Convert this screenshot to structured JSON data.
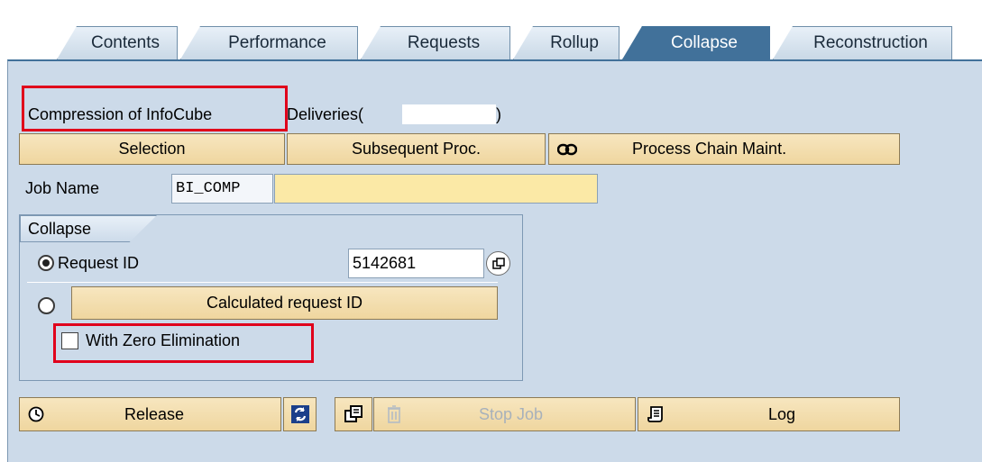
{
  "tabs": [
    {
      "label": "Contents"
    },
    {
      "label": "Performance"
    },
    {
      "label": "Requests"
    },
    {
      "label": "Rollup"
    },
    {
      "label": "Collapse"
    },
    {
      "label": "Reconstruction"
    }
  ],
  "header": {
    "compression_label": "Compression of InfoCube",
    "cube_prefix": "Deliveries(",
    "cube_suffix": ")"
  },
  "toolbar": {
    "selection": "Selection",
    "subsequent": "Subsequent Proc.",
    "process_chain": "Process Chain Maint."
  },
  "job": {
    "label": "Job Name",
    "prefix": "BI_COMP",
    "value": ""
  },
  "collapse": {
    "title": "Collapse",
    "request_id_label": "Request ID",
    "request_id_value": "5142681",
    "calculated_label": "Calculated request ID",
    "zero_elim_label": "With Zero Elimination"
  },
  "actions": {
    "release": "Release",
    "stop_job": "Stop Job",
    "log": "Log"
  },
  "icons": {
    "release": "clock-icon",
    "refresh": "refresh-icon",
    "copy": "copy-icon",
    "delete": "trash-icon",
    "log": "log-scroll-icon",
    "chain": "chain-link-icon",
    "f4": "value-help-icon"
  },
  "colors": {
    "active_tab": "#41719a",
    "panel": "#ccdae9",
    "button": "#efd69f",
    "highlight": "#e0001b",
    "job_input": "#fbe9a6"
  }
}
